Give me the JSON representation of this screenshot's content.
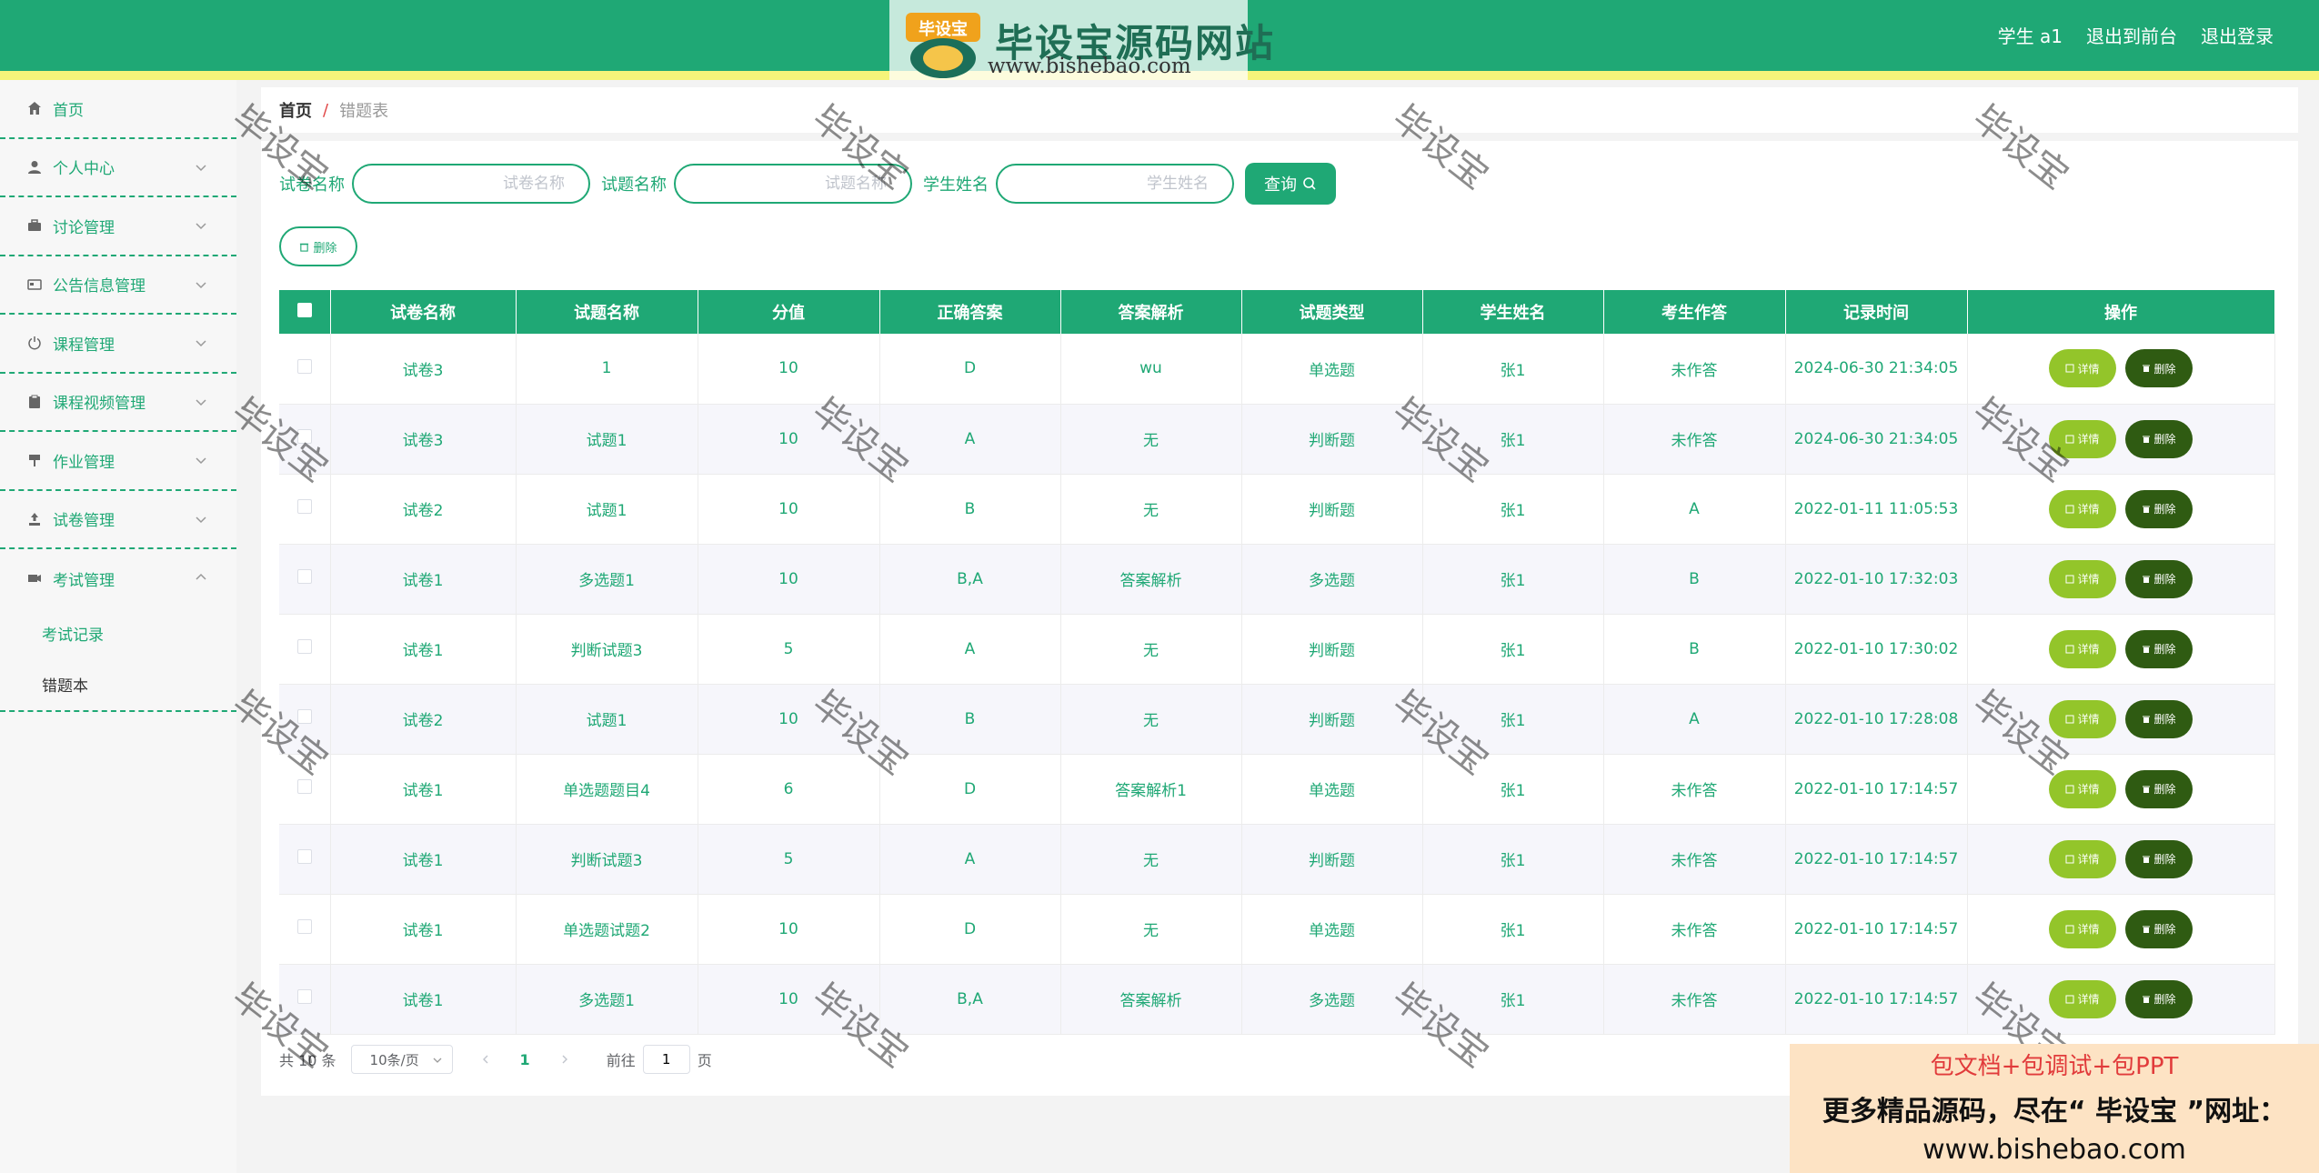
{
  "header": {
    "logo_badge": "毕设宝",
    "logo_title": "毕设宝源码网站",
    "logo_url": "www.bishebao.com",
    "links": [
      "学生 a1",
      "退出到前台",
      "退出登录"
    ],
    "colors": {
      "primary": "#1fa875",
      "stripe": "#f6f47a"
    }
  },
  "sidebar": {
    "items": [
      {
        "label": "首页",
        "icon": "home-icon"
      },
      {
        "label": "个人中心",
        "icon": "user-icon"
      },
      {
        "label": "讨论管理",
        "icon": "briefcase-icon"
      },
      {
        "label": "公告信息管理",
        "icon": "card-icon"
      },
      {
        "label": "课程管理",
        "icon": "power-icon"
      },
      {
        "label": "课程视频管理",
        "icon": "clipboard-icon"
      },
      {
        "label": "作业管理",
        "icon": "pin-icon"
      },
      {
        "label": "试卷管理",
        "icon": "upload-icon"
      },
      {
        "label": "考试管理",
        "icon": "camera-icon"
      }
    ],
    "submenu": [
      {
        "label": "考试记录",
        "active": false
      },
      {
        "label": "错题本",
        "active": true
      }
    ]
  },
  "breadcrumb": {
    "home": "首页",
    "sep": "/",
    "current": "错题表"
  },
  "search": {
    "fields": [
      {
        "label": "试卷名称",
        "placeholder": "试卷名称"
      },
      {
        "label": "试题名称",
        "placeholder": "试题名称"
      },
      {
        "label": "学生姓名",
        "placeholder": "学生姓名"
      }
    ],
    "query_label": "查询"
  },
  "delete_label": "删除",
  "table": {
    "headers": [
      "试卷名称",
      "试题名称",
      "分值",
      "正确答案",
      "答案解析",
      "试题类型",
      "学生姓名",
      "考生作答",
      "记录时间",
      "操作"
    ],
    "rows": [
      [
        "试卷3",
        "1",
        "10",
        "D",
        "wu",
        "单选题",
        "张1",
        "未作答",
        "2024-06-30 21:34:05"
      ],
      [
        "试卷3",
        "试题1",
        "10",
        "A",
        "无",
        "判断题",
        "张1",
        "未作答",
        "2024-06-30 21:34:05"
      ],
      [
        "试卷2",
        "试题1",
        "10",
        "B",
        "无",
        "判断题",
        "张1",
        "A",
        "2022-01-11 11:05:53"
      ],
      [
        "试卷1",
        "多选题1",
        "10",
        "B,A",
        "答案解析",
        "多选题",
        "张1",
        "B",
        "2022-01-10 17:32:03"
      ],
      [
        "试卷1",
        "判断试题3",
        "5",
        "A",
        "无",
        "判断题",
        "张1",
        "B",
        "2022-01-10 17:30:02"
      ],
      [
        "试卷2",
        "试题1",
        "10",
        "B",
        "无",
        "判断题",
        "张1",
        "A",
        "2022-01-10 17:28:08"
      ],
      [
        "试卷1",
        "单选题题目4",
        "6",
        "D",
        "答案解析1",
        "单选题",
        "张1",
        "未作答",
        "2022-01-10 17:14:57"
      ],
      [
        "试卷1",
        "判断试题3",
        "5",
        "A",
        "无",
        "判断题",
        "张1",
        "未作答",
        "2022-01-10 17:14:57"
      ],
      [
        "试卷1",
        "单选题试题2",
        "10",
        "D",
        "无",
        "单选题",
        "张1",
        "未作答",
        "2022-01-10 17:14:57"
      ],
      [
        "试卷1",
        "多选题1",
        "10",
        "B,A",
        "答案解析",
        "多选题",
        "张1",
        "未作答",
        "2022-01-10 17:14:57"
      ]
    ],
    "detail_label": "详情",
    "delete_label": "删除"
  },
  "pagination": {
    "total_text": "共 10 条",
    "page_size": "10条/页",
    "current_page": "1",
    "goto_prefix": "前往",
    "goto_value": "1",
    "goto_suffix": "页"
  },
  "watermark": "毕设宝",
  "ad": {
    "line1": "包文档+包调试+包PPT",
    "line2": "更多精品源码，尽在“ 毕设宝 ”网址：",
    "line3": "www.bishebao.com"
  }
}
